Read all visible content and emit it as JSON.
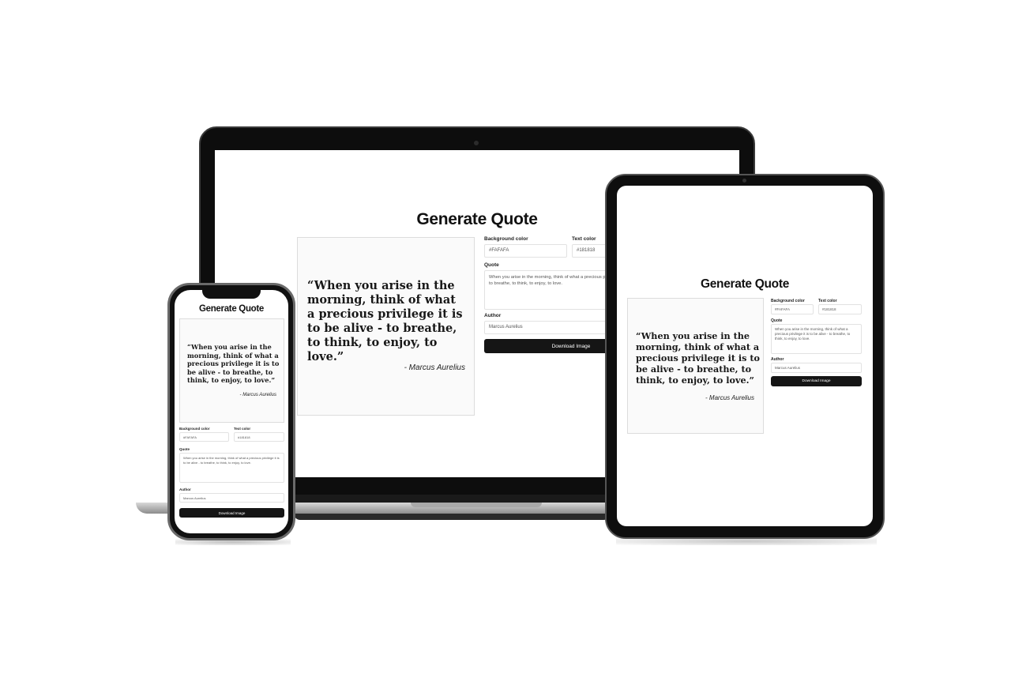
{
  "app": {
    "title": "Generate Quote",
    "background_color_label": "Background color",
    "background_color_value": "#FAFAFA",
    "text_color_label": "Text color",
    "text_color_value": "#181818",
    "quote_label": "Quote",
    "quote_value": "When you arise in the morning, think of what a precious privilege it is to be alive - to breathe, to think, to enjoy, to love.",
    "author_label": "Author",
    "author_value": "Marcus Aurelius",
    "download_label": "Download Image"
  },
  "preview": {
    "quote_display": "“When you arise in the morning, think of what a precious privilege it is to be alive - to breathe, to think, to enjoy, to love.”",
    "author_display": "- Marcus Aurelius"
  },
  "colors": {
    "card_background": "#fafafa",
    "text": "#181818",
    "button": "#151515",
    "device_frame": "#0e0e0e"
  }
}
